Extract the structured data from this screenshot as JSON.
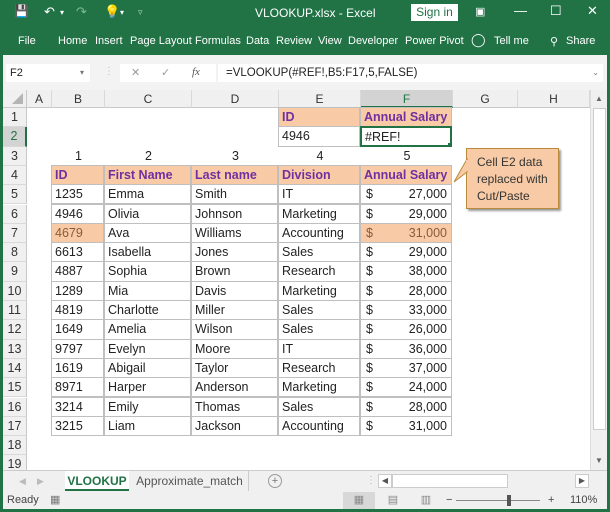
{
  "titlebar": {
    "title": "VLOOKUP.xlsx  -  Excel",
    "sign_in": "Sign in",
    "icons": [
      "save-icon",
      "undo-icon",
      "redo-icon",
      "lightbulb-icon",
      "customize-qat-icon",
      "ribbon-display-icon",
      "minimize-icon",
      "maximize-icon",
      "close-icon"
    ]
  },
  "ribbon": {
    "tabs": [
      "File",
      "Home",
      "Insert",
      "Page Layout",
      "Formulas",
      "Data",
      "Review",
      "View",
      "Developer",
      "Power Pivot"
    ],
    "tell_me": "Tell me",
    "share": "Share"
  },
  "formula_bar": {
    "name_box": "F2",
    "cancel": "✕",
    "enter": "✓",
    "fx": "fx",
    "formula": "=VLOOKUP(#REF!,B5:F17,5,FALSE)"
  },
  "grid": {
    "columns": [
      "A",
      "B",
      "C",
      "D",
      "E",
      "F",
      "G",
      "H"
    ],
    "selected_column": "F",
    "rows": [
      "1",
      "2",
      "3",
      "4",
      "5",
      "6",
      "7",
      "8",
      "9",
      "10",
      "11",
      "12",
      "13",
      "14",
      "15",
      "16",
      "17",
      "18",
      "19"
    ],
    "selected_row": "2",
    "lookup": {
      "id_label": "ID",
      "salary_label": "Annual Salary",
      "id_value": "4946",
      "result_value": "#REF!"
    },
    "col_index": [
      "1",
      "2",
      "3",
      "4",
      "5"
    ],
    "table_headers": [
      "ID",
      "First Name",
      "Last name",
      "Division",
      "Annual Salary"
    ],
    "currency": "$",
    "table_rows": [
      {
        "id": "1235",
        "first": "Emma",
        "last": "Smith",
        "division": "IT",
        "salary": "27,000"
      },
      {
        "id": "4946",
        "first": "Olivia",
        "last": "Johnson",
        "division": "Marketing",
        "salary": "29,000"
      },
      {
        "id": "4679",
        "first": "Ava",
        "last": "Williams",
        "division": "Accounting",
        "salary": "31,000"
      },
      {
        "id": "6613",
        "first": "Isabella",
        "last": "Jones",
        "division": "Sales",
        "salary": "29,000"
      },
      {
        "id": "4887",
        "first": "Sophia",
        "last": "Brown",
        "division": "Research",
        "salary": "38,000"
      },
      {
        "id": "1289",
        "first": "Mia",
        "last": "Davis",
        "division": "Marketing",
        "salary": "28,000"
      },
      {
        "id": "4819",
        "first": "Charlotte",
        "last": "Miller",
        "division": "Sales",
        "salary": "33,000"
      },
      {
        "id": "1649",
        "first": "Amelia",
        "last": "Wilson",
        "division": "Sales",
        "salary": "26,000"
      },
      {
        "id": "9797",
        "first": "Evelyn",
        "last": "Moore",
        "division": "IT",
        "salary": "36,000"
      },
      {
        "id": "1619",
        "first": "Abigail",
        "last": "Taylor",
        "division": "Research",
        "salary": "37,000"
      },
      {
        "id": "8971",
        "first": "Harper",
        "last": "Anderson",
        "division": "Marketing",
        "salary": "24,000"
      },
      {
        "id": "3214",
        "first": "Emily",
        "last": "Thomas",
        "division": "Sales",
        "salary": "28,000"
      },
      {
        "id": "3215",
        "first": "Liam",
        "last": "Jackson",
        "division": "Accounting",
        "salary": "31,000"
      }
    ],
    "highlighted_row_index": 2,
    "callout": [
      "Cell E2 data",
      "replaced with",
      "Cut/Paste"
    ]
  },
  "colors": {
    "excel_green": "#217346",
    "header_fill": "#f8cba6",
    "header_text": "#7030a0"
  },
  "sheets": {
    "tabs": [
      "VLOOKUP",
      "Approximate_match"
    ],
    "active": "VLOOKUP"
  },
  "status": {
    "ready": "Ready",
    "zoom": "110%",
    "zoom_minus": "−",
    "zoom_plus": "+"
  }
}
